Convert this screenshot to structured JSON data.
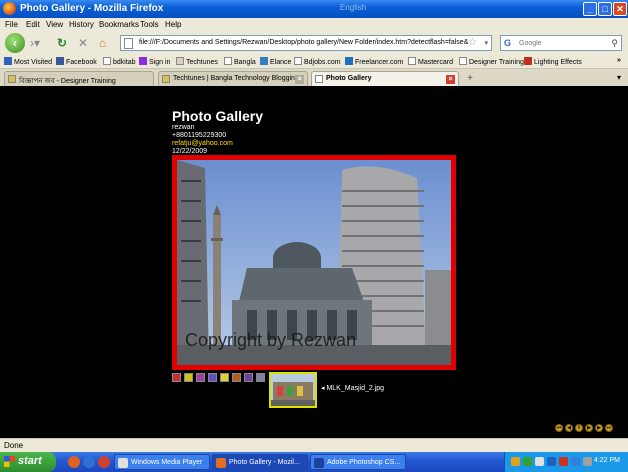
{
  "window": {
    "title": "Photo Gallery - Mozilla Firefox",
    "lang_indicator": "English",
    "minimize": "_",
    "maximize": "□",
    "close": "✕"
  },
  "menu": [
    "File",
    "Edit",
    "View",
    "History",
    "Bookmarks",
    "Tools",
    "Help"
  ],
  "nav": {
    "url": "file:///F:/Documents and Settings/Rezwan/Desktop/photo gallery/New Folder/index.htm?detectflash=false&",
    "search_placeholder": "Google",
    "search_engine_glyph": "G"
  },
  "bookmarks": [
    "Most Visited",
    "Facebook",
    "bdkitab",
    "Sign in",
    "Techtunes",
    "Bangla",
    "Elance",
    "Bdjobs.com",
    "Freelancer.com",
    "Mastercard",
    "Designer Training",
    "Lighting Effects"
  ],
  "bookmarks_overflow": "»",
  "tabs": [
    {
      "label": "বিজ্ঞাপন জব - Designer Training",
      "active": false
    },
    {
      "label": "Techtunes | Bangla Technology Bloggin...",
      "active": false
    },
    {
      "label": "Photo Gallery",
      "active": true
    }
  ],
  "page": {
    "title": "Photo Gallery",
    "name": "rezwan",
    "phone": "+8801195229300",
    "email": "refatju@yahoo.com",
    "date": "12/22/2009",
    "watermark": "Copyright by Rezwan",
    "caption": "◂ MLK_Masjid_2.jpg",
    "thumbnails": [
      "#c83030",
      "#d0c020",
      "#a040a0",
      "#6050c0",
      "#e0d030",
      "#b06020",
      "#7040a0",
      "#8080a0"
    ]
  },
  "status": "Done",
  "taskbar": {
    "start": "start",
    "tasks": [
      {
        "label": "Windows Media Player",
        "active": false
      },
      {
        "label": "Photo Gallery - Mozil...",
        "active": true
      },
      {
        "label": "Adobe Photoshop CS...",
        "active": false
      }
    ],
    "time": "4:22 PM"
  }
}
